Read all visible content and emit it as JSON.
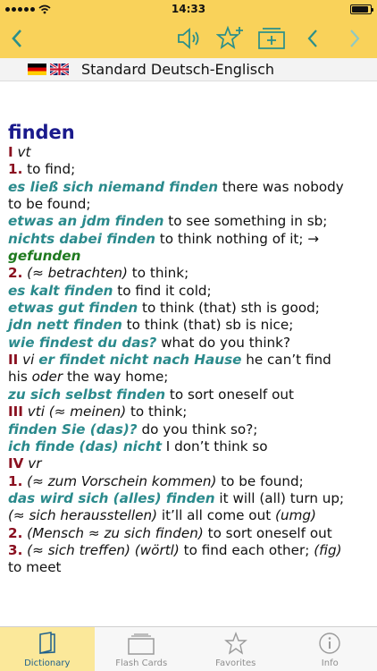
{
  "status": {
    "time": "14:33"
  },
  "language_bar": {
    "title": "Standard Deutsch-Englisch"
  },
  "entry": {
    "headword": "finden",
    "lines": [
      [
        {
          "t": "roman",
          "v": "I"
        },
        {
          "t": "gram",
          "v": " vt"
        }
      ],
      [
        {
          "t": "num",
          "v": "1."
        },
        {
          "t": "plain",
          "v": " to find;"
        }
      ],
      [
        {
          "t": "ex",
          "v": "es ließ sich niemand finden"
        },
        {
          "t": "plain",
          "v": " there was nobody"
        }
      ],
      [
        {
          "t": "plain",
          "v": "to be found;"
        }
      ],
      [
        {
          "t": "ex",
          "v": "etwas an jdm finden"
        },
        {
          "t": "plain",
          "v": " to see something in sb;"
        }
      ],
      [
        {
          "t": "ex",
          "v": "nichts dabei finden"
        },
        {
          "t": "plain",
          "v": " to think nothing of it; →"
        }
      ],
      [
        {
          "t": "xref",
          "v": "gefunden"
        }
      ],
      [
        {
          "t": "num",
          "v": "2."
        },
        {
          "t": "gloss",
          "v": " (≈ betrachten)"
        },
        {
          "t": "plain",
          "v": " to think;"
        }
      ],
      [
        {
          "t": "ex",
          "v": "es kalt finden"
        },
        {
          "t": "plain",
          "v": " to find it cold;"
        }
      ],
      [
        {
          "t": "ex",
          "v": "etwas gut finden"
        },
        {
          "t": "plain",
          "v": " to think (that) sth is good;"
        }
      ],
      [
        {
          "t": "ex",
          "v": "jdn nett finden"
        },
        {
          "t": "plain",
          "v": " to think (that) sb is nice;"
        }
      ],
      [
        {
          "t": "ex",
          "v": "wie findest du das?"
        },
        {
          "t": "plain",
          "v": " what do you think?"
        }
      ],
      [
        {
          "t": "roman",
          "v": "II"
        },
        {
          "t": "gram",
          "v": " vi"
        },
        {
          "t": "plain",
          "v": " "
        },
        {
          "t": "ex",
          "v": "er findet nicht nach Hause"
        },
        {
          "t": "plain",
          "v": " he can’t find"
        }
      ],
      [
        {
          "t": "plain",
          "v": "his "
        },
        {
          "t": "gloss",
          "v": "oder"
        },
        {
          "t": "plain",
          "v": " the way home;"
        }
      ],
      [
        {
          "t": "ex",
          "v": "zu sich selbst finden"
        },
        {
          "t": "plain",
          "v": " to sort oneself out"
        }
      ],
      [
        {
          "t": "roman",
          "v": "III"
        },
        {
          "t": "gram",
          "v": " vti"
        },
        {
          "t": "gloss",
          "v": " (≈ meinen)"
        },
        {
          "t": "plain",
          "v": " to think;"
        }
      ],
      [
        {
          "t": "ex",
          "v": "finden Sie (das)?"
        },
        {
          "t": "plain",
          "v": " do you think so?;"
        }
      ],
      [
        {
          "t": "ex",
          "v": "ich finde (das) nicht"
        },
        {
          "t": "plain",
          "v": " I don’t think so"
        }
      ],
      [
        {
          "t": "roman",
          "v": "IV"
        },
        {
          "t": "gram",
          "v": " vr"
        }
      ],
      [
        {
          "t": "num",
          "v": "1."
        },
        {
          "t": "gloss",
          "v": " (≈ zum Vorschein kommen)"
        },
        {
          "t": "plain",
          "v": " to be found;"
        }
      ],
      [
        {
          "t": "ex",
          "v": "das wird sich (alles) finden"
        },
        {
          "t": "plain",
          "v": " it will (all) turn up;"
        }
      ],
      [
        {
          "t": "gloss",
          "v": "(≈ sich herausstellen)"
        },
        {
          "t": "plain",
          "v": " it’ll all come out "
        },
        {
          "t": "gloss",
          "v": "(umg)"
        }
      ],
      [
        {
          "t": "num",
          "v": "2."
        },
        {
          "t": "gloss",
          "v": " (Mensch ≈ zu sich finden)"
        },
        {
          "t": "plain",
          "v": " to sort oneself out"
        }
      ],
      [
        {
          "t": "num",
          "v": "3."
        },
        {
          "t": "gloss",
          "v": " (≈ sich treffen) (wörtl)"
        },
        {
          "t": "plain",
          "v": " to find each other; "
        },
        {
          "t": "gloss",
          "v": "(fig)"
        }
      ],
      [
        {
          "t": "plain",
          "v": "to meet"
        }
      ]
    ]
  },
  "tabs": [
    {
      "label": "Dictionary",
      "icon": "book-icon",
      "active": true
    },
    {
      "label": "Flash Cards",
      "icon": "cards-icon",
      "active": false
    },
    {
      "label": "Favorites",
      "icon": "star-icon",
      "active": false
    },
    {
      "label": "Info",
      "icon": "info-icon",
      "active": false
    }
  ],
  "colors": {
    "header": "#f9d25a",
    "accent": "#2a8f8a",
    "headword": "#1a1a8c",
    "example": "#2a8a8c",
    "sense_number": "#8a1020",
    "xref": "#1f7a1f"
  }
}
